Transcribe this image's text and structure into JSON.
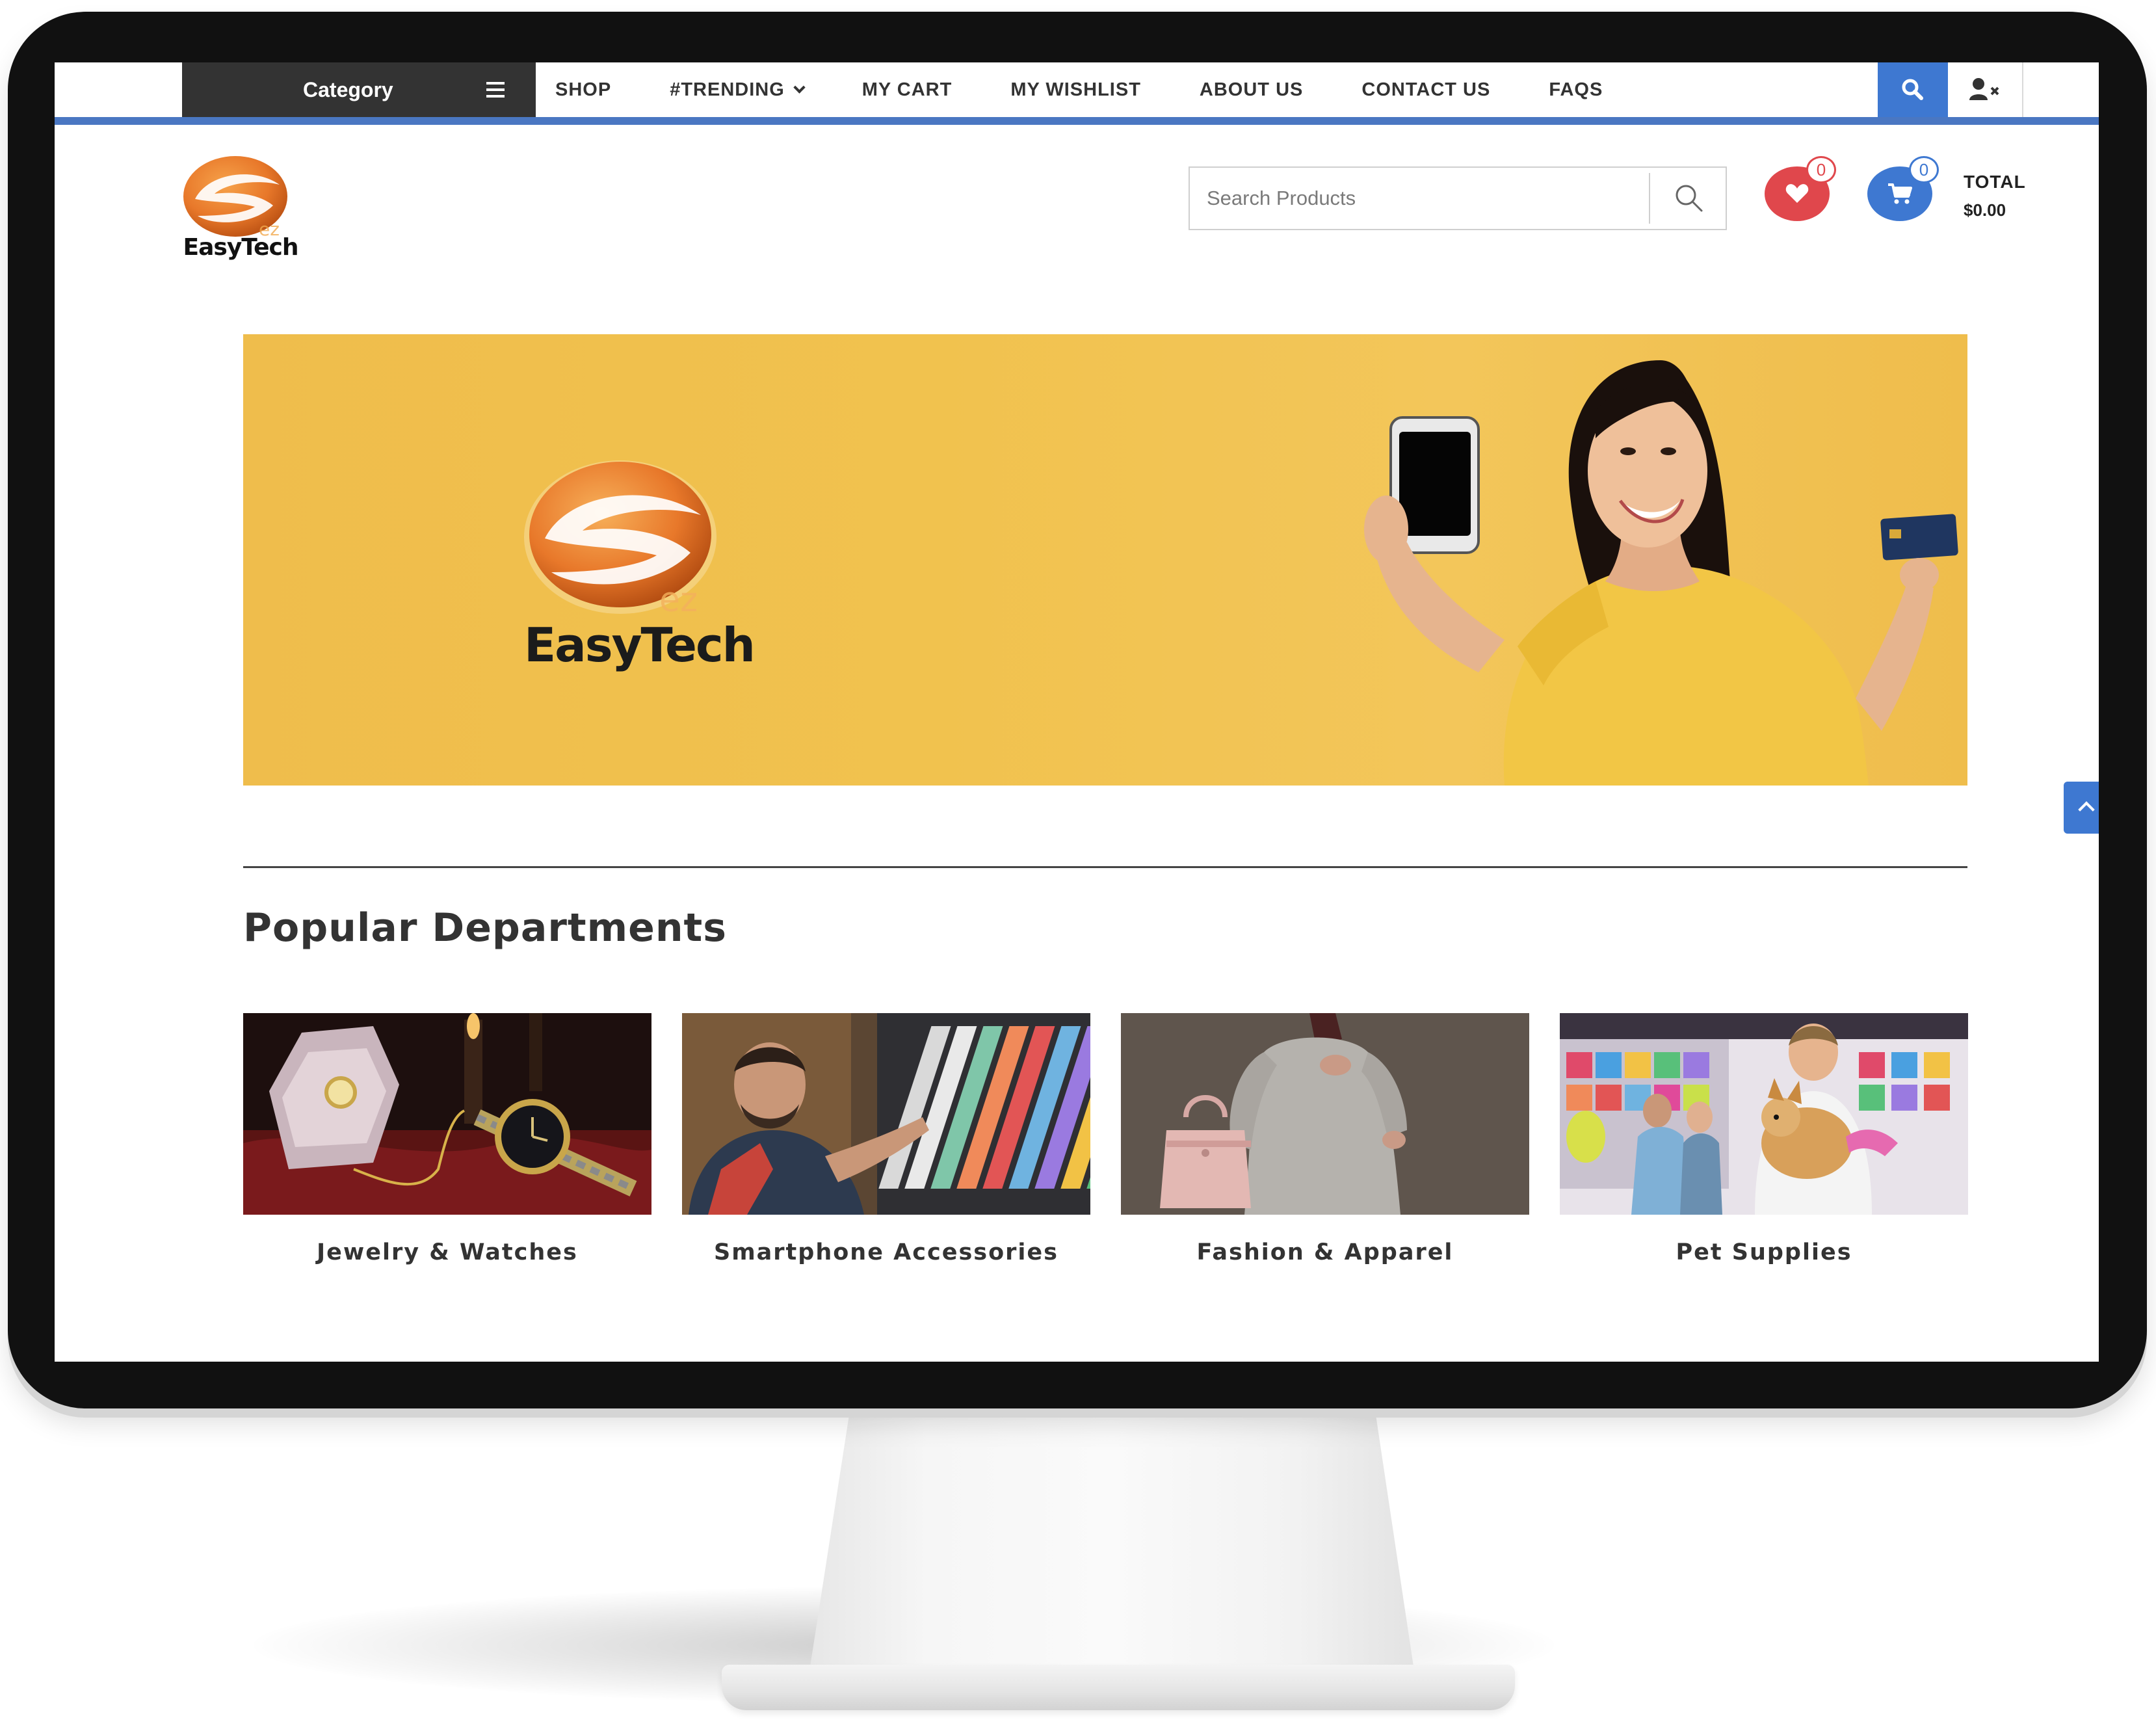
{
  "nav": {
    "category_label": "Category",
    "items": [
      {
        "label": "SHOP"
      },
      {
        "label": "#TRENDING"
      },
      {
        "label": "MY CART"
      },
      {
        "label": "MY WISHLIST"
      },
      {
        "label": "ABOUT US"
      },
      {
        "label": "CONTACT US"
      },
      {
        "label": "FAQS"
      }
    ]
  },
  "header": {
    "logo_text": "EasyTech",
    "search_placeholder": "Search Products",
    "wishlist_count": "0",
    "cart_count": "0",
    "total_label": "TOTAL",
    "total_value": "$0.00"
  },
  "hero": {
    "logo_text": "EasyTech"
  },
  "departments": {
    "title": "Popular Departments",
    "items": [
      {
        "label": "Jewelry & Watches"
      },
      {
        "label": "Smartphone Accessories"
      },
      {
        "label": "Fashion & Apparel"
      },
      {
        "label": "Pet Supplies"
      }
    ]
  },
  "colors": {
    "accent_blue": "#3e78d1",
    "wishlist_red": "#e0474c",
    "category_bg": "#333333",
    "banner_yellow": "#f1c24e",
    "logo_orange": "#e8782a"
  },
  "icons": [
    "hamburger-icon",
    "chevron-down-icon",
    "search-icon",
    "user-remove-icon",
    "heart-icon",
    "cart-icon",
    "chevron-up-icon"
  ]
}
